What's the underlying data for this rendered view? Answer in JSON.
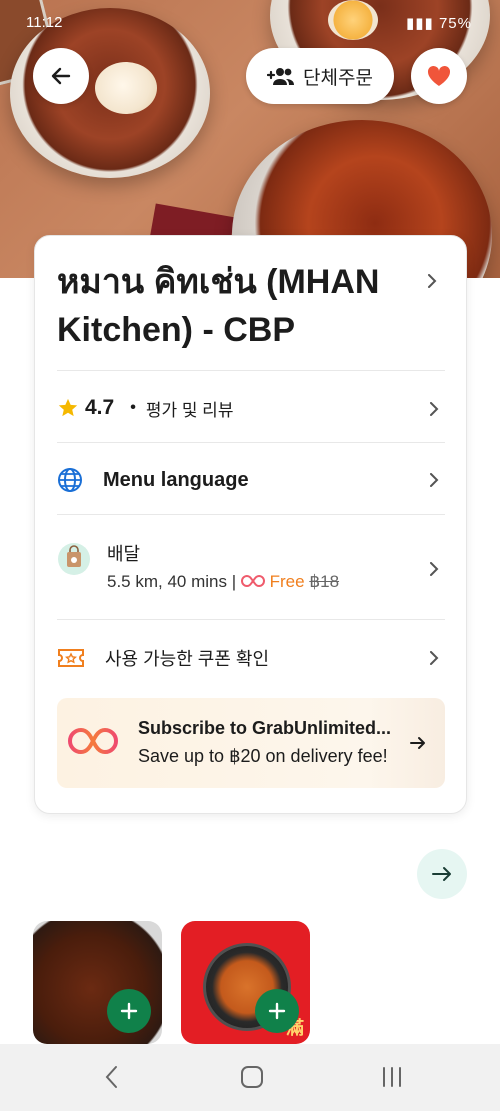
{
  "status_bar": {
    "time": "11:12",
    "battery": "75%"
  },
  "header": {
    "group_order_label": "단체주문"
  },
  "restaurant": {
    "name": "หมาน คิทเช่น (MHAN Kitchen) - CBP"
  },
  "rating": {
    "value": "4.7",
    "reviews_label": "평가 및 리뷰"
  },
  "menu_language": {
    "label": "Menu language"
  },
  "delivery": {
    "title": "배달",
    "distance_time": "5.5 km, 40 mins |",
    "fee_label": "Free",
    "original_fee": "฿18"
  },
  "coupons": {
    "label": "사용 가능한 쿠폰 확인"
  },
  "promo": {
    "title": "Subscribe to GrabUnlimited...",
    "subtitle": "Save up to ฿20 on delivery fee!"
  },
  "menu_items": [
    {
      "badge": "滿"
    }
  ],
  "colors": {
    "accent_green": "#10814a",
    "fee_orange": "#f07f1e",
    "heart_red": "#f0553a"
  }
}
